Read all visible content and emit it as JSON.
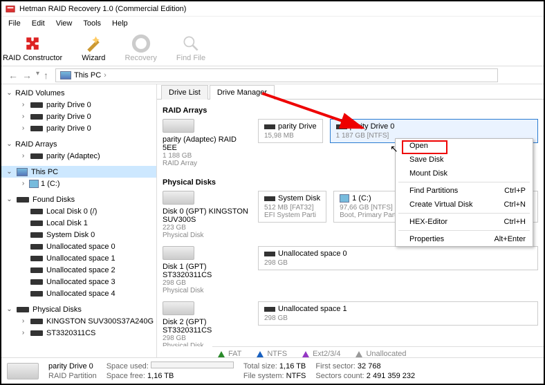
{
  "window": {
    "title": "Hetman RAID Recovery 1.0 (Commercial Edition)"
  },
  "menu": {
    "items": [
      "File",
      "Edit",
      "View",
      "Tools",
      "Help"
    ]
  },
  "toolbar": {
    "raid_constructor": "RAID Constructor",
    "wizard": "Wizard",
    "recovery": "Recovery",
    "find_file": "Find File"
  },
  "breadcrumb": {
    "root": "This PC",
    "sep": "›"
  },
  "tree": {
    "raid_volumes": "RAID Volumes",
    "parity_drive0_a": "parity Drive 0",
    "parity_drive0_b": "parity Drive 0",
    "parity_drive0_c": "parity Drive 0",
    "raid_arrays": "RAID Arrays",
    "parity_adaptec": "parity (Adaptec)",
    "this_pc": "This PC",
    "vol_c": "1 (C:)",
    "found_disks": "Found Disks",
    "local0": "Local Disk 0 (/)",
    "local1": "Local Disk 1",
    "system0": "System Disk 0",
    "un0": "Unallocated space 0",
    "un1": "Unallocated space 1",
    "un2": "Unallocated space 2",
    "un3": "Unallocated space 3",
    "un4": "Unallocated space 4",
    "physical_disks": "Physical Disks",
    "kingston": "KINGSTON SUV300S37A240G",
    "st1": "ST3320311CS"
  },
  "tabs": {
    "drive_list": "Drive List",
    "drive_manager": "Drive Manager"
  },
  "sections": {
    "raid_arrays": "RAID Arrays",
    "physical_disks": "Physical Disks"
  },
  "array0": {
    "name": "parity (Adaptec) RAID 5EE",
    "size": "1 188 GB",
    "type": "RAID Array",
    "p1_name": "parity Drive",
    "p1_size": "15,98 MB",
    "p2_name": "parity Drive 0",
    "p2_size": "1 187 GB [NTFS]"
  },
  "pd0": {
    "name": "Disk 0 (GPT) KINGSTON SUV300S",
    "size": "223 GB",
    "type": "Physical Disk",
    "p1_name": "System Disk",
    "p1_l1": "512 MB [FAT32]",
    "p1_l2": "EFI System Parti",
    "p2_name": "1 (C:)",
    "p2_l1": "97,66 GB [NTFS]",
    "p2_l2": "Boot, Primary Partition"
  },
  "pd1": {
    "name": "Disk 1 (GPT) ST3320311CS",
    "size": "298 GB",
    "type": "Physical Disk",
    "p1_name": "Unallocated space 0",
    "p1_size": "298 GB"
  },
  "pd2": {
    "name": "Disk 2 (GPT) ST3320311CS",
    "size": "298 GB",
    "type": "Physical Disk",
    "p1_name": "Unallocated space 1",
    "p1_size": "298 GB"
  },
  "legend": {
    "fat": "FAT",
    "ntfs": "NTFS",
    "ext": "Ext2/3/4",
    "unalloc": "Unallocated"
  },
  "ctx": {
    "open": "Open",
    "save_disk": "Save Disk",
    "mount_disk": "Mount Disk",
    "find_partitions": "Find Partitions",
    "create_vd": "Create Virtual Disk",
    "hex": "HEX-Editor",
    "properties": "Properties",
    "sc_find": "Ctrl+P",
    "sc_create": "Ctrl+N",
    "sc_hex": "Ctrl+H",
    "sc_prop": "Alt+Enter"
  },
  "status": {
    "sel_name": "parity Drive 0",
    "sel_type": "RAID Partition",
    "space_used": "Space used:",
    "space_free": "Space free:",
    "free_val": "1,16 TB",
    "total_size": "Total size:",
    "total_val": "1,16 TB",
    "fs": "File system:",
    "fs_val": "NTFS",
    "first_sector": "First sector:",
    "first_val": "32 768",
    "sectors_count": "Sectors count:",
    "sectors_val": "2 491 359 232"
  }
}
